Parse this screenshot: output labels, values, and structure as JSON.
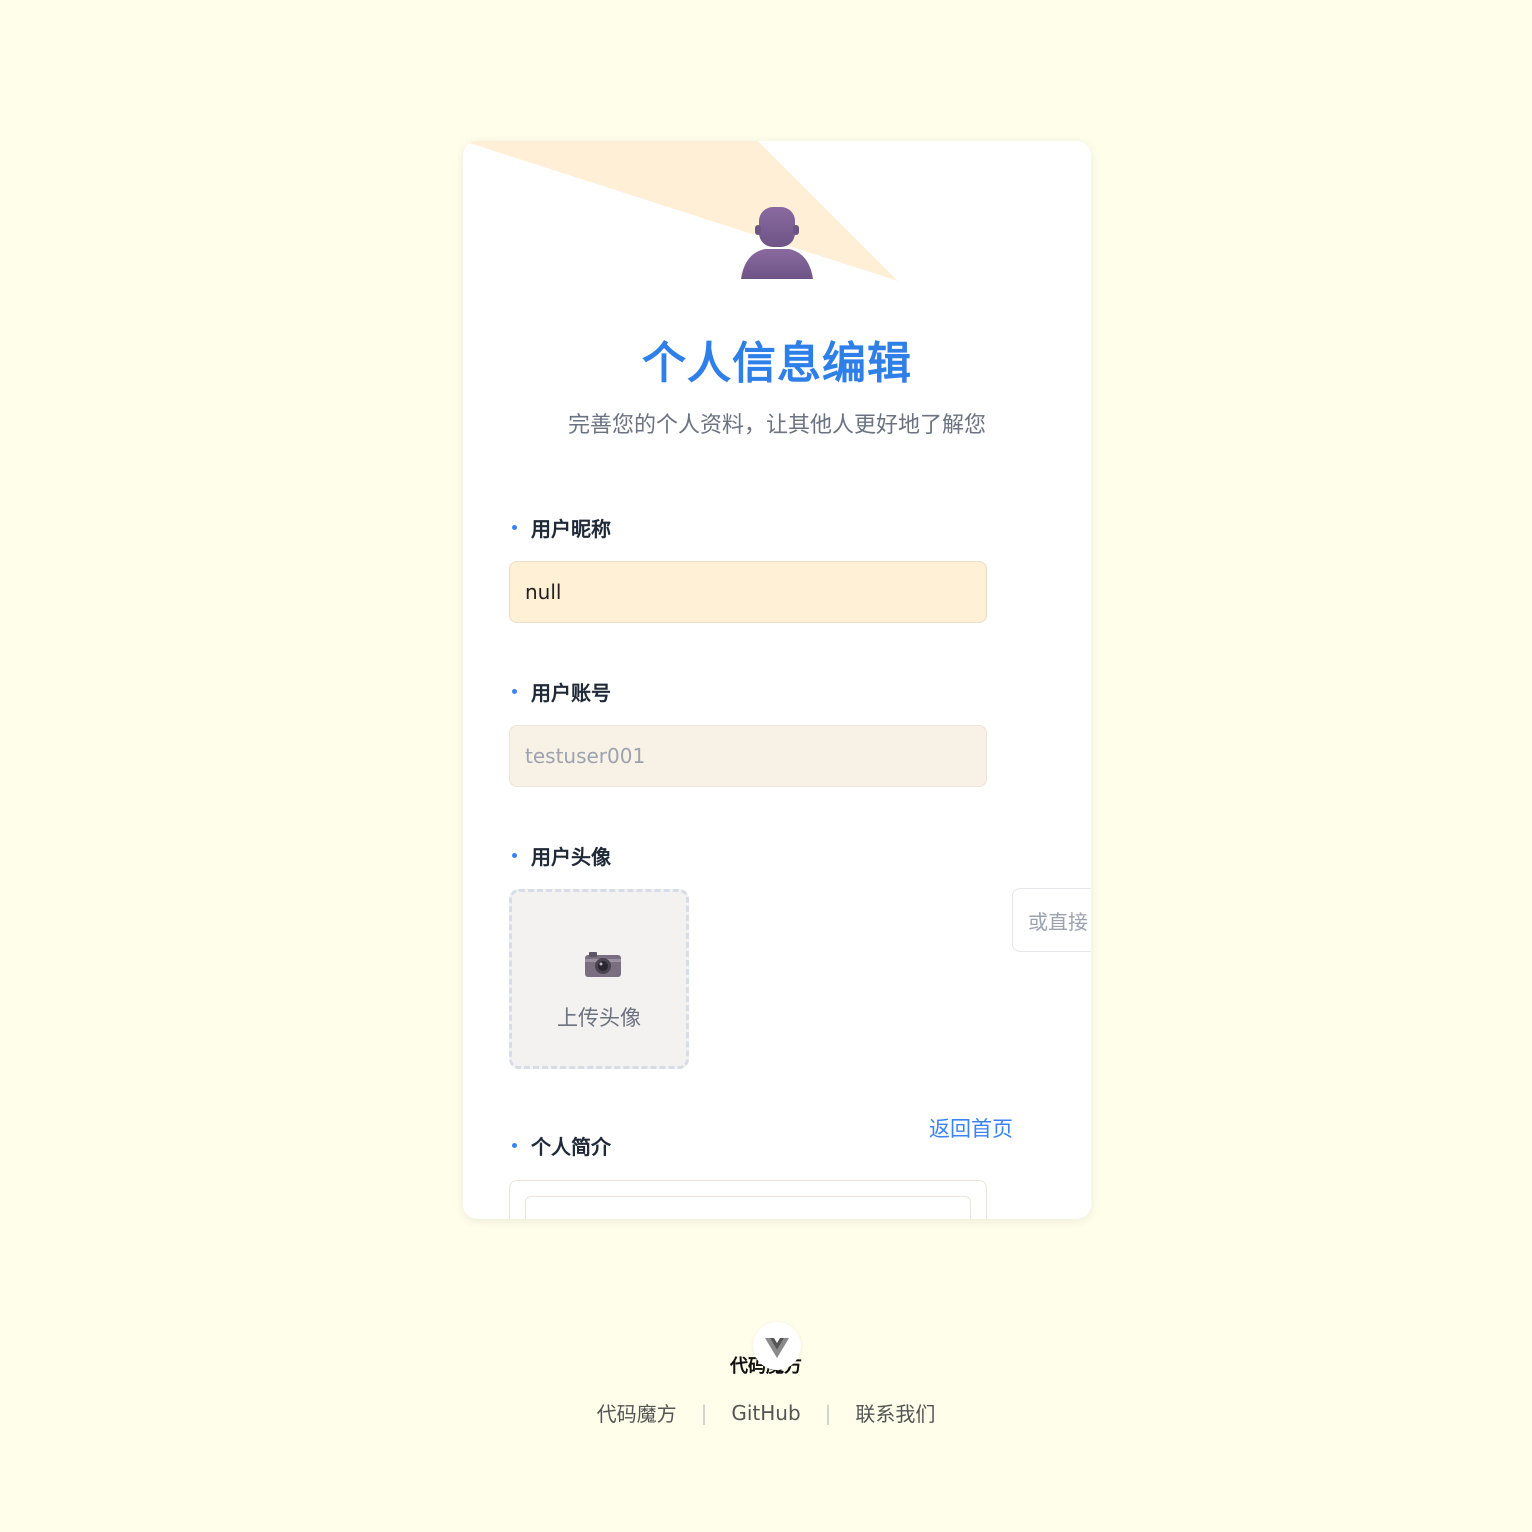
{
  "header": {
    "title": "个人信息编辑",
    "subtitle": "完善您的个人资料，让其他人更好地了解您"
  },
  "form": {
    "nickname": {
      "label": "用户昵称",
      "value": "null"
    },
    "account": {
      "label": "用户账号",
      "value": "testuser001"
    },
    "avatar": {
      "label": "用户头像",
      "upload_label": "上传头像",
      "url_placeholder": "或直接"
    },
    "bio": {
      "label": "个人简介"
    }
  },
  "nav": {
    "back_home": "返回首页"
  },
  "footer": {
    "brand": "代码魔方",
    "links": [
      "代码魔方",
      "GitHub",
      "联系我们"
    ]
  },
  "icons": {
    "header_avatar": "user-silhouette-icon",
    "upload": "camera-icon",
    "footer_logo": "vue-logo-icon"
  },
  "colors": {
    "page_background": "#fffeea",
    "accent_blue": "#2f7fe8",
    "card_pattern": "#ffefd6"
  }
}
